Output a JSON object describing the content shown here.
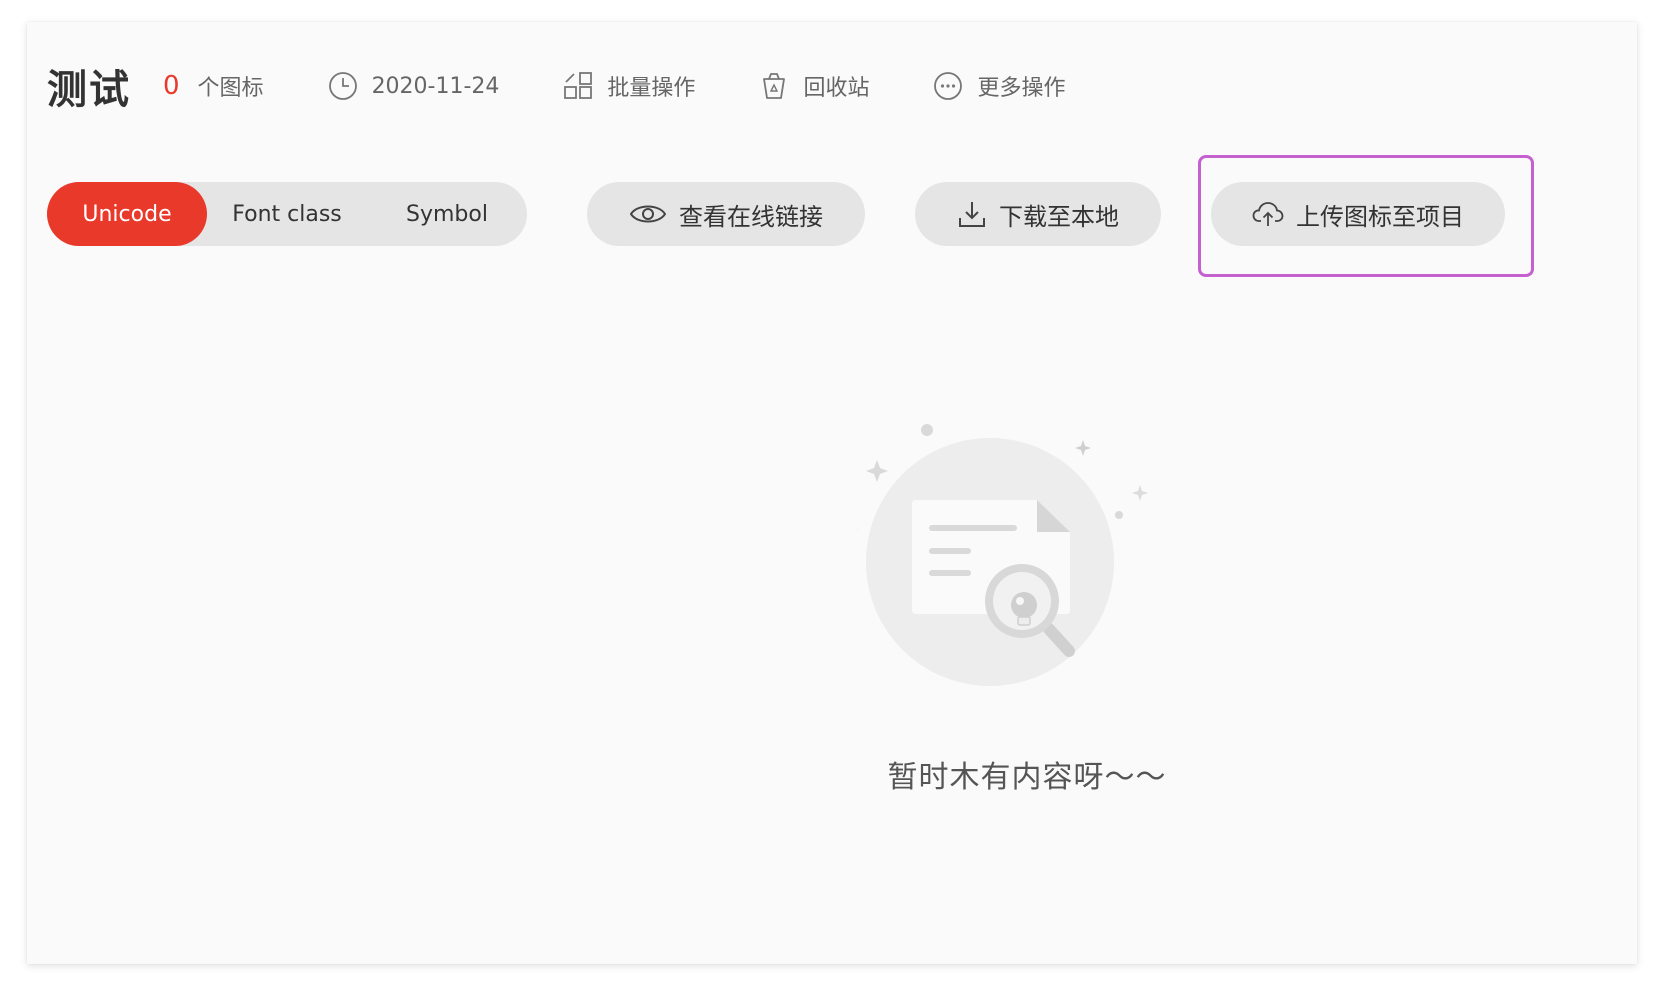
{
  "project": {
    "title": "测试",
    "icon_count": "0",
    "icon_count_label": "个图标",
    "date": "2020-11-24",
    "batch_label": "批量操作",
    "trash_label": "回收站",
    "more_label": "更多操作"
  },
  "tabs": {
    "items": [
      {
        "label": "Unicode",
        "active": true
      },
      {
        "label": "Font class",
        "active": false
      },
      {
        "label": "Symbol",
        "active": false
      }
    ]
  },
  "actions": {
    "view_link_label": "查看在线链接",
    "download_label": "下载至本地",
    "upload_label": "上传图标至项目"
  },
  "empty_state": {
    "message": "暂时木有内容呀～～"
  },
  "icons": {
    "date": "clock-icon",
    "batch": "grid-icon",
    "trash": "trash-icon",
    "more": "more-icon",
    "view": "eye-icon",
    "download": "download-icon",
    "upload": "cloud-upload-icon"
  },
  "colors": {
    "accent": "#e8392b",
    "highlight": "#c561cf",
    "pill_bg": "#e5e5e5",
    "panel_bg": "#fafafa"
  }
}
